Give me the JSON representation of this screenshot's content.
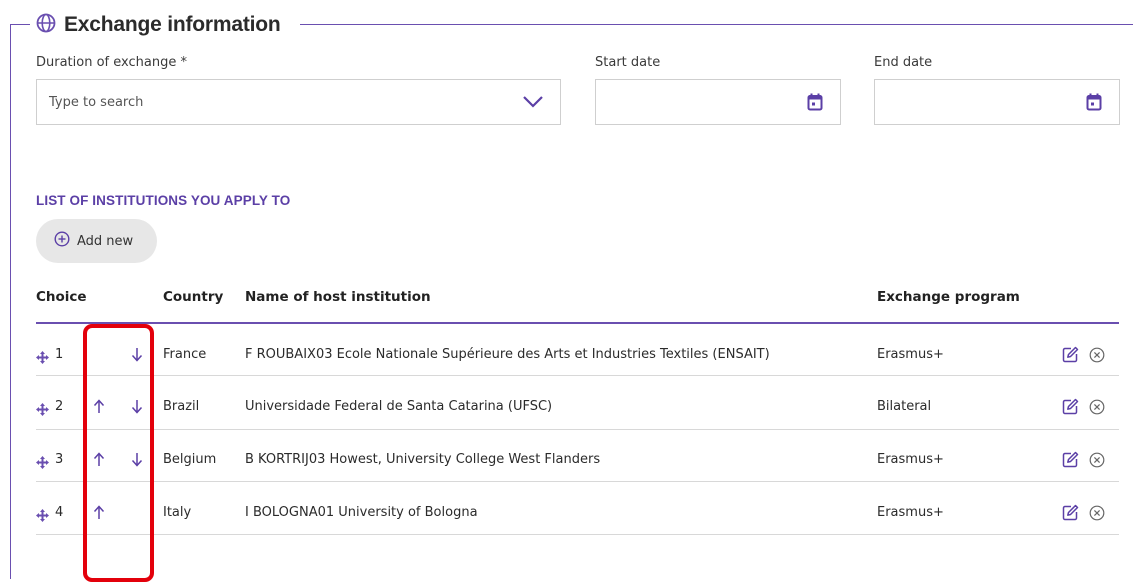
{
  "section": {
    "title": "Exchange information",
    "icon": "globe-icon"
  },
  "form": {
    "duration_label": "Duration of exchange *",
    "duration_placeholder": "Type to search",
    "start_label": "Start date",
    "end_label": "End date"
  },
  "institutions": {
    "title": "LIST OF INSTITUTIONS YOU APPLY TO",
    "add_new_label": "Add new",
    "columns": {
      "choice": "Choice",
      "country": "Country",
      "name": "Name of host institution",
      "program": "Exchange program"
    },
    "rows": [
      {
        "choice": "1",
        "country": "France",
        "name": "F ROUBAIX03 Ecole Nationale Supérieure des Arts et Industries Textiles (ENSAIT)",
        "program": "Erasmus+",
        "can_move_up": false,
        "can_move_down": true
      },
      {
        "choice": "2",
        "country": "Brazil",
        "name": "Universidade Federal de Santa Catarina (UFSC)",
        "program": "Bilateral",
        "can_move_up": true,
        "can_move_down": true
      },
      {
        "choice": "3",
        "country": "Belgium",
        "name": "B KORTRIJ03 Howest, University College West Flanders",
        "program": "Erasmus+",
        "can_move_up": true,
        "can_move_down": true
      },
      {
        "choice": "4",
        "country": "Italy",
        "name": "I BOLOGNA01 University of Bologna",
        "program": "Erasmus+",
        "can_move_up": true,
        "can_move_down": false
      }
    ]
  },
  "colors": {
    "accent": "#6a4fb0",
    "section_title": "#5b3fa6",
    "highlight": "#e3000b"
  }
}
